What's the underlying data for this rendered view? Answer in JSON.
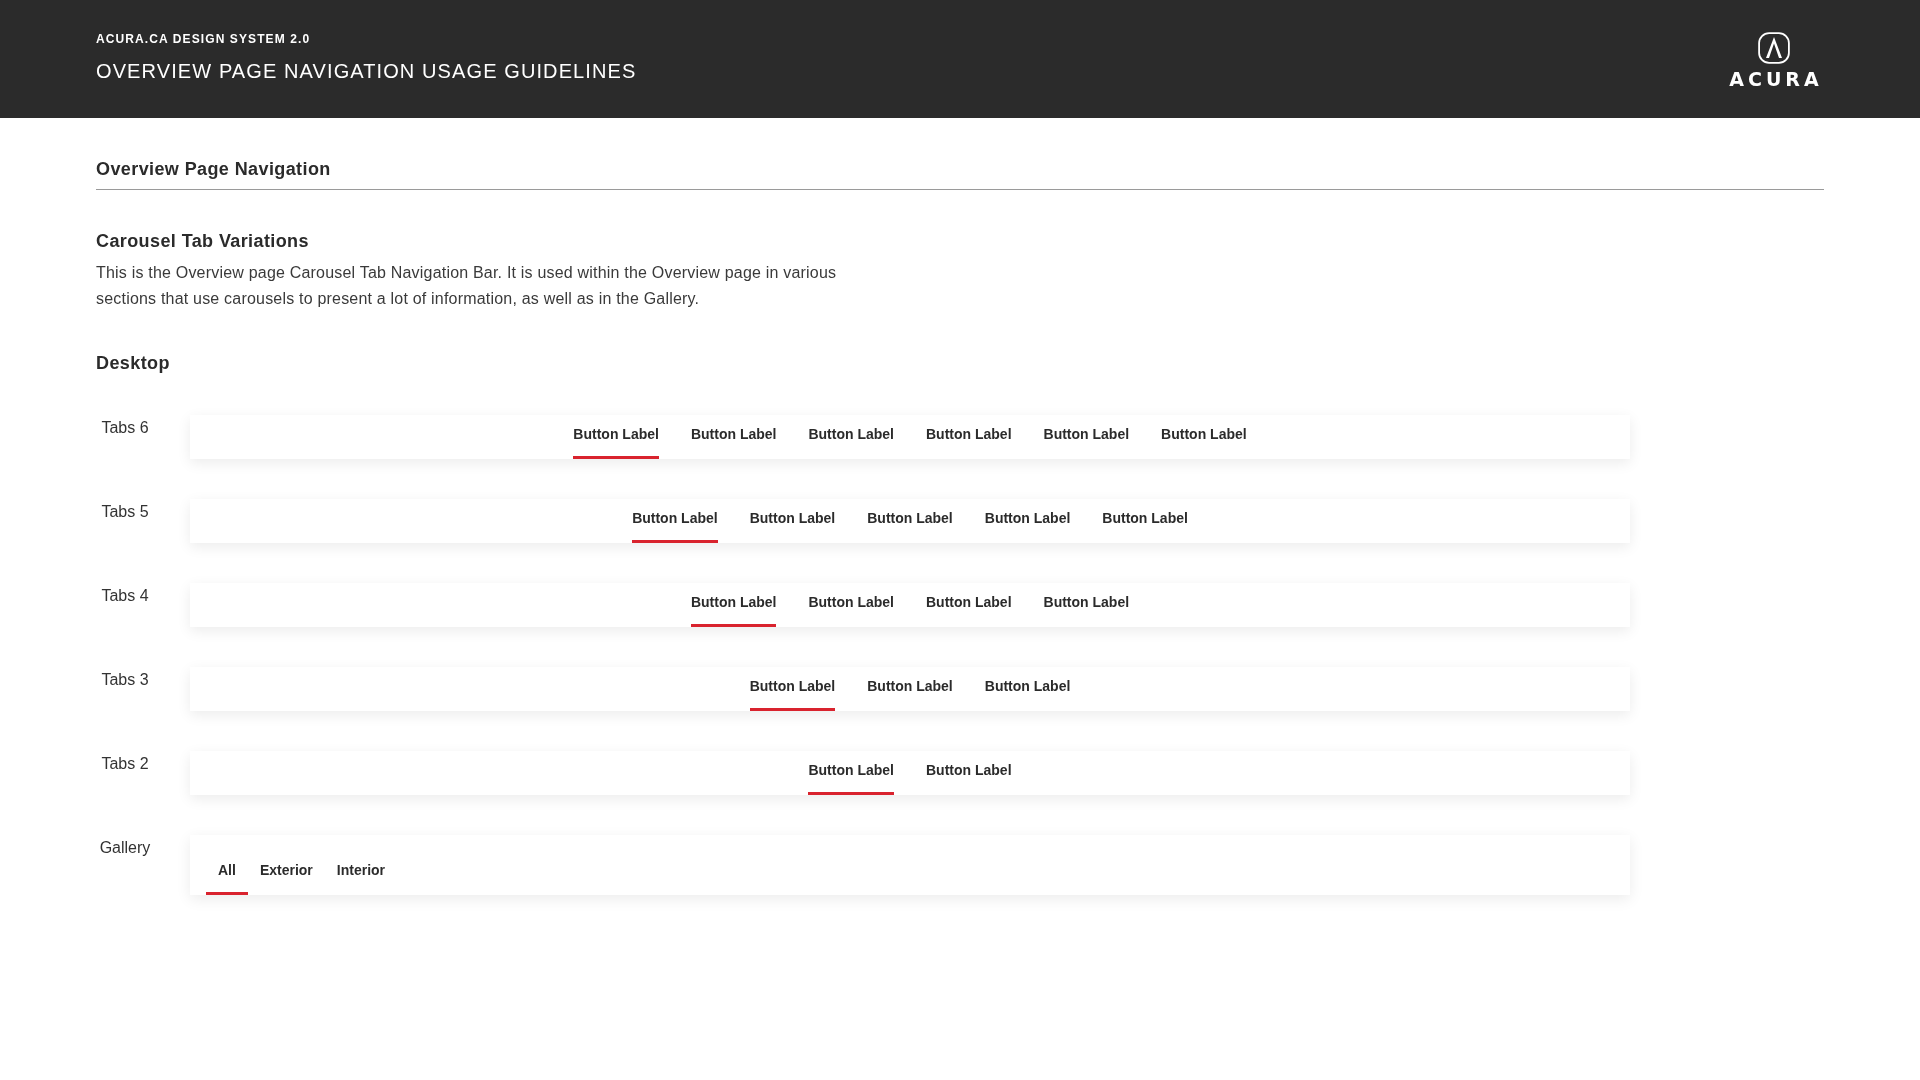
{
  "header": {
    "subtitle": "ACURA.CA DESIGN SYSTEM 2.0",
    "title": "OVERVIEW PAGE NAVIGATION USAGE GUIDELINES",
    "logo_wordmark": "ACURA"
  },
  "section": {
    "title": "Overview Page Navigation"
  },
  "subsection": {
    "title": "Carousel Tab Variations",
    "description": "This is the Overview page Carousel Tab Navigation Bar. It is used within the Overview page in various sections that use carousels to present a lot of information, as well as in the Gallery."
  },
  "group": {
    "title": "Desktop"
  },
  "rows": [
    {
      "label": "Tabs 6",
      "kind": "carousel",
      "tabs": [
        {
          "label": "Button Label",
          "selected": true
        },
        {
          "label": "Button Label",
          "selected": false
        },
        {
          "label": "Button Label",
          "selected": false
        },
        {
          "label": "Button Label",
          "selected": false
        },
        {
          "label": "Button Label",
          "selected": false
        },
        {
          "label": "Button Label",
          "selected": false
        }
      ]
    },
    {
      "label": "Tabs 5",
      "kind": "carousel",
      "tabs": [
        {
          "label": "Button Label",
          "selected": true
        },
        {
          "label": "Button Label",
          "selected": false
        },
        {
          "label": "Button Label",
          "selected": false
        },
        {
          "label": "Button Label",
          "selected": false
        },
        {
          "label": "Button Label",
          "selected": false
        }
      ]
    },
    {
      "label": "Tabs 4",
      "kind": "carousel",
      "tabs": [
        {
          "label": "Button Label",
          "selected": true
        },
        {
          "label": "Button Label",
          "selected": false
        },
        {
          "label": "Button Label",
          "selected": false
        },
        {
          "label": "Button Label",
          "selected": false
        }
      ]
    },
    {
      "label": "Tabs 3",
      "kind": "carousel",
      "tabs": [
        {
          "label": "Button Label",
          "selected": true
        },
        {
          "label": "Button Label",
          "selected": false
        },
        {
          "label": "Button Label",
          "selected": false
        }
      ]
    },
    {
      "label": "Tabs 2",
      "kind": "carousel",
      "tabs": [
        {
          "label": "Button Label",
          "selected": true
        },
        {
          "label": "Button Label",
          "selected": false
        }
      ]
    },
    {
      "label": "Gallery",
      "kind": "gallery",
      "tabs": [
        {
          "label": "All",
          "selected": true
        },
        {
          "label": "Exterior",
          "selected": false
        },
        {
          "label": "Interior",
          "selected": false
        }
      ]
    }
  ]
}
